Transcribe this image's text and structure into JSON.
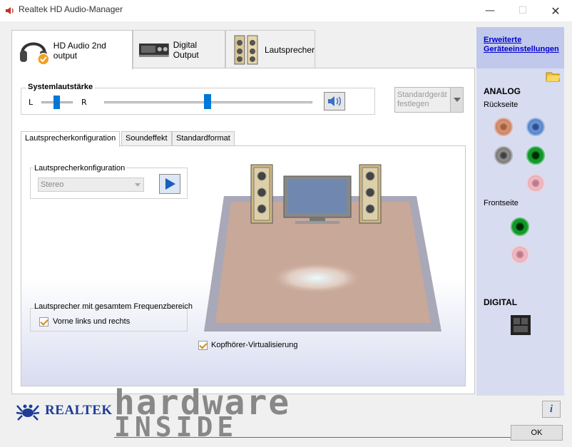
{
  "window": {
    "title": "Realtek HD Audio-Manager"
  },
  "tabs": [
    {
      "label": "HD Audio 2nd output",
      "icon": "headphones-icon"
    },
    {
      "label": "Digital Output",
      "icon": "digital-output-icon"
    },
    {
      "label": "Lautsprecher",
      "icon": "speakers-icon"
    }
  ],
  "volume": {
    "title": "Systemlautstärke",
    "left_label": "L",
    "right_label": "R",
    "balance": 0.5,
    "level": 0.5,
    "default_device": "Standardgerät festlegen"
  },
  "subtabs": [
    "Lautsprecherkonfiguration",
    "Soundeffekt",
    "Standardformat"
  ],
  "config": {
    "group_title": "Lautsprecherkonfiguration",
    "select_value": "Stereo",
    "fullrange_title": "Lautsprecher mit gesamtem Frequenzbereich",
    "fullrange_option": "Vorne links und rechts",
    "headphone_virtualization": "Kopfhörer-Virtualisierung"
  },
  "sidebar": {
    "link": "Erweiterte Geräteeinstellungen",
    "analog": "ANALOG",
    "rear": "Rückseite",
    "front": "Frontseite",
    "digital": "DIGITAL",
    "colors": {
      "orange": "#c87a50",
      "blue": "#4a78c0",
      "gray": "#707070",
      "green": "#108a20",
      "pink": "#e2a0b0"
    }
  },
  "footer": {
    "brand": "REALTEK",
    "ok": "OK",
    "watermark_top": "hardware",
    "watermark_bottom": "inside"
  }
}
